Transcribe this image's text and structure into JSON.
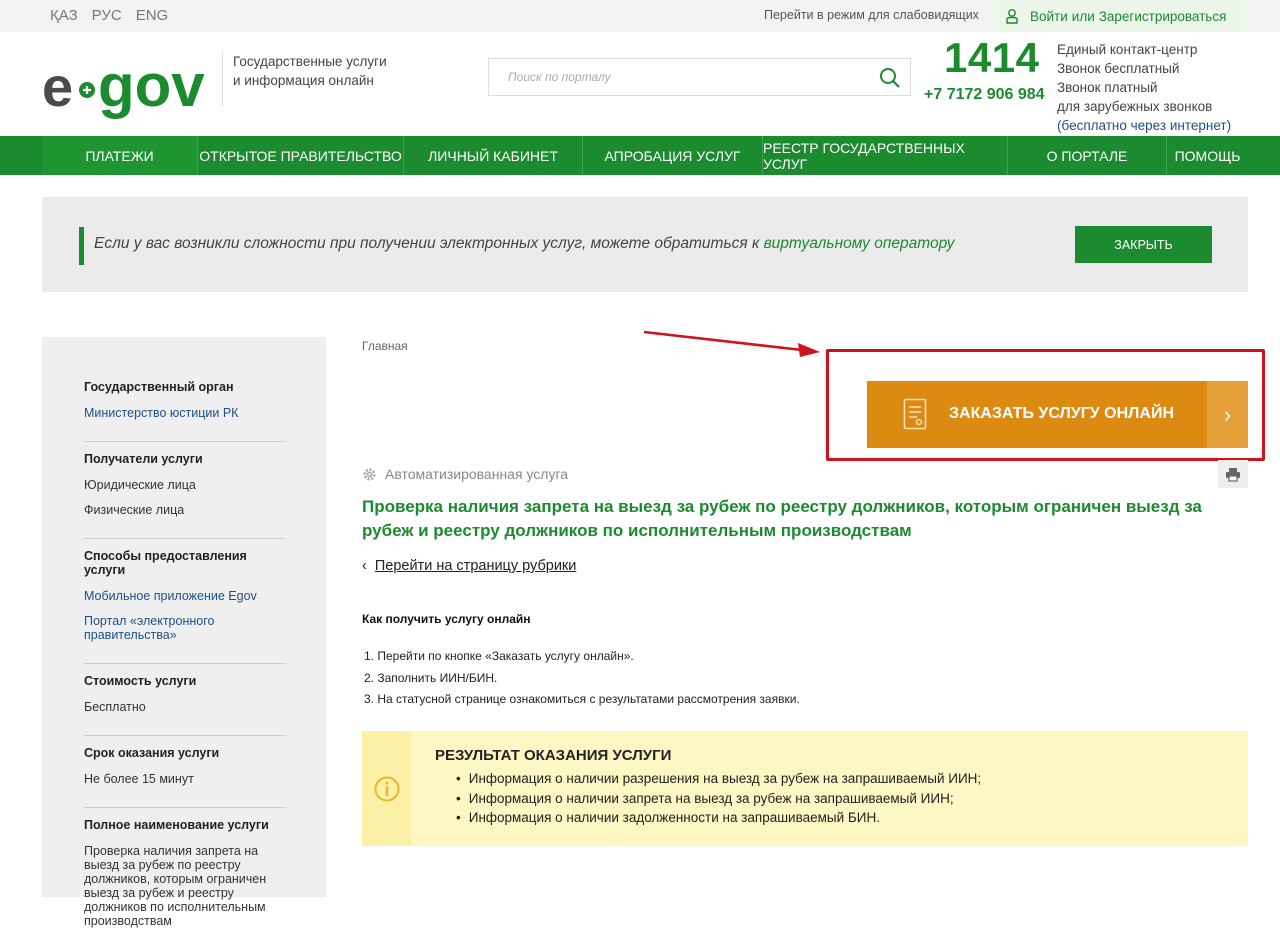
{
  "topbar": {
    "languages": [
      "ҚАЗ",
      "РУС",
      "ENG"
    ],
    "low_vision": "Перейти в режим для слабовидящих",
    "login": "Войти",
    "login_or": "или",
    "register": "Зарегистрироваться"
  },
  "header": {
    "tagline_line1": "Государственные услуги",
    "tagline_line2": "и информация онлайн",
    "search_placeholder": "Поиск по порталу",
    "short_phone": "1414",
    "long_phone": "+7 7172 906 984",
    "contact_center": "Единый контакт-центр",
    "free_call": "Звонок бесплатный",
    "paid_call": "Звонок платный",
    "foreign_calls": "для зарубежных звонков",
    "free_internet": "(бесплатно через интернет)"
  },
  "nav": [
    "ПЛАТЕЖИ",
    "ОТКРЫТОЕ ПРАВИТЕЛЬСТВО",
    "ЛИЧНЫЙ КАБИНЕТ",
    "АПРОБАЦИЯ УСЛУГ",
    "РЕЕСТР ГОСУДАРСТВЕННЫХ УСЛУГ",
    "О ПОРТАЛЕ",
    "ПОМОЩЬ"
  ],
  "notice": {
    "text": "Если у вас возникли сложности при получении электронных услуг, можете обратиться к ",
    "operator_link": "виртуальному оператору",
    "close": "ЗАКРЫТЬ"
  },
  "sidebar": {
    "org_title": "Государственный орган",
    "org_value": "Министерство юстиции РК",
    "recipients_title": "Получатели услуги",
    "recipient_1": "Юридические лица",
    "recipient_2": "Физические лица",
    "methods_title": "Способы предоставления услуги",
    "method_1": "Мобильное приложение Egov",
    "method_2": "Портал «электронного правительства»",
    "cost_title": "Стоимость услуги",
    "cost_value": "Бесплатно",
    "term_title": "Срок оказания услуги",
    "term_value": "Не более 15 минут",
    "fullname_title": "Полное наименование услуги",
    "fullname_value": "Проверка наличия запрета на выезд за рубеж по реестру должников, которым ограничен выезд за рубеж и реестру должников по исполнительным производствам"
  },
  "main": {
    "breadcrumb": "Главная",
    "order_button": "ЗАКАЗАТЬ УСЛУГУ ОНЛАЙН",
    "automated": "Автоматизированная услуга",
    "title": "Проверка наличия запрета на выезд за рубеж по реестру должников, которым ограничен выезд за рубеж и реестру должников по исполнительным производствам",
    "back_link": "Перейти на страницу рубрики",
    "how_title": "Как получить услугу  онлайн",
    "steps": [
      "1. Перейти по кнопке «Заказать услугу онлайн».",
      "2. Заполнить ИИН/БИН.",
      "3. На статусной странице ознакомиться с результатами рассмотрения заявки."
    ],
    "result_title": "РЕЗУЛЬТАТ ОКАЗАНИЯ УСЛУГИ",
    "results": [
      "Информация о наличии разрешения на выезд за рубеж на запрашиваемый ИИН;",
      "Информация о наличии запрета на выезд за рубеж на запрашиваемый ИИН;",
      "Информация о наличии задолженности на запрашиваемый БИН."
    ]
  },
  "colors": {
    "brand_green": "#1c8a2e",
    "order_orange": "#dc8a12",
    "highlight_red": "#d0121c",
    "result_yellow": "#fdf7c3"
  }
}
